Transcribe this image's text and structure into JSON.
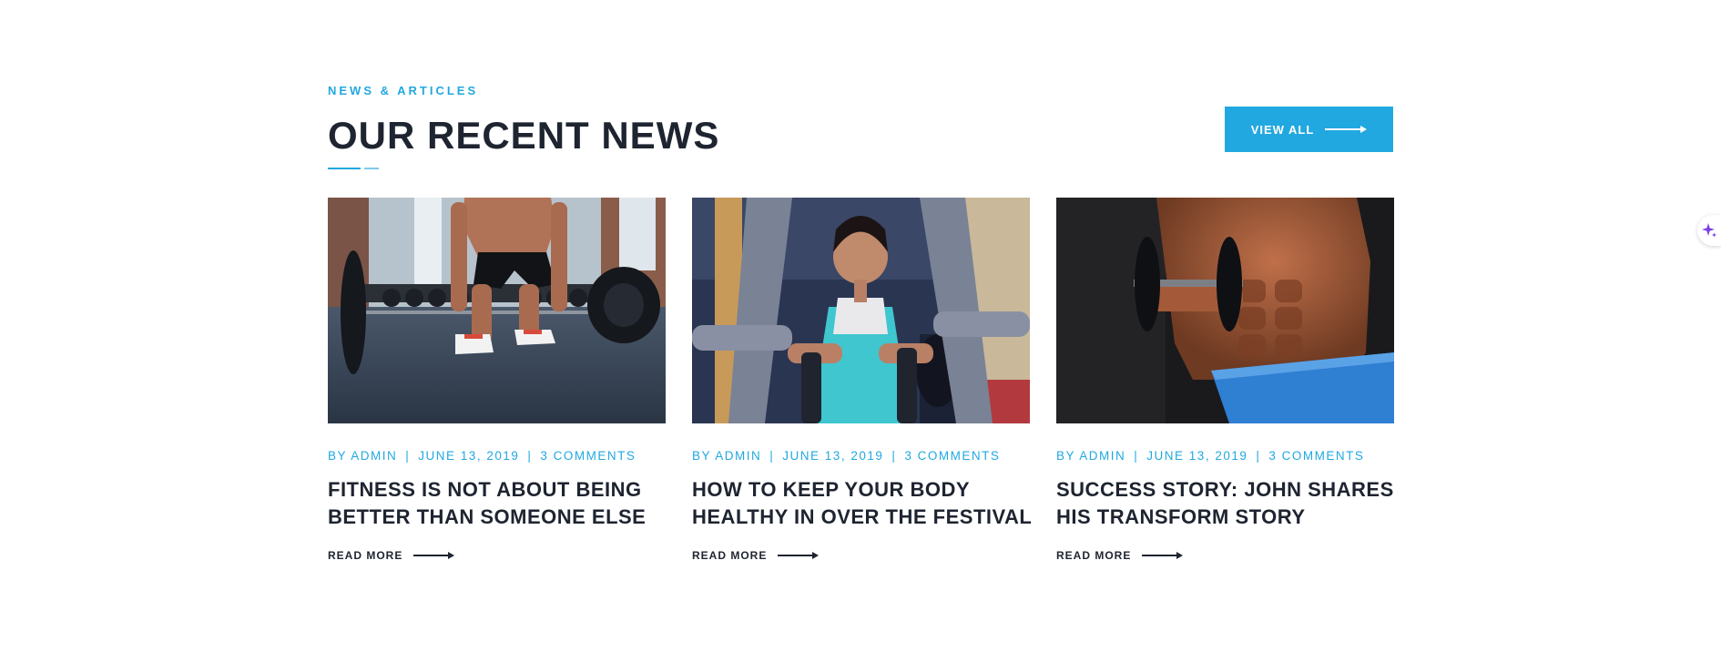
{
  "section": {
    "eyebrow": "NEWS & ARTICLES",
    "heading": "OUR RECENT NEWS",
    "view_all_label": "VIEW ALL"
  },
  "posts": [
    {
      "image": "deadlift-barbell-gym-photo",
      "author": "BY ADMIN",
      "date": "JUNE 13, 2019",
      "comments": "3 COMMENTS",
      "title": "FITNESS IS NOT ABOUT BEING BETTER THAN SOMEONE ELSE",
      "read_more": "READ MORE"
    },
    {
      "image": "woman-chest-press-machine-photo",
      "author": "BY ADMIN",
      "date": "JUNE 13, 2019",
      "comments": "3 COMMENTS",
      "title": "HOW TO KEEP YOUR BODY HEALTHY IN OVER THE FESTIVAL",
      "read_more": "READ MORE"
    },
    {
      "image": "man-dumbbell-curl-photo",
      "author": "BY ADMIN",
      "date": "JUNE 13, 2019",
      "comments": "3 COMMENTS",
      "title": "SUCCESS STORY: JOHN SHARES HIS TRANSFORM STORY",
      "read_more": "READ MORE"
    }
  ],
  "colors": {
    "accent": "#22a8e0",
    "heading": "#1e2430",
    "background": "#ffffff"
  },
  "icons": {
    "view_all": "arrow-right-icon",
    "read_more": "arrow-right-icon",
    "assistant": "sparkle-icon"
  }
}
